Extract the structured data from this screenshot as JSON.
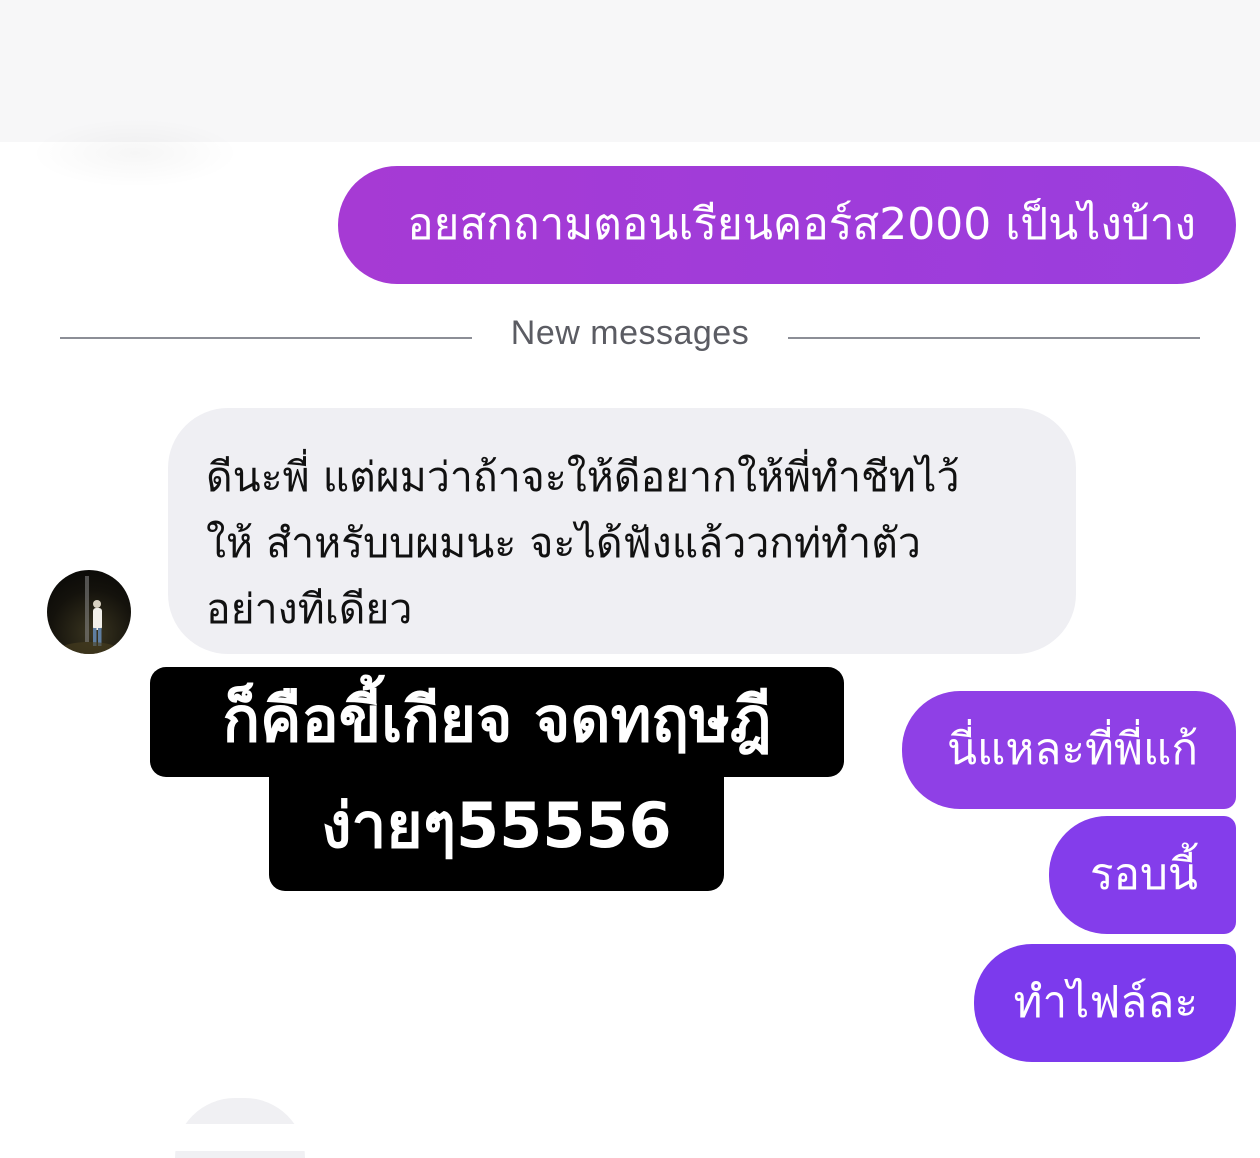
{
  "conversation": {
    "outgoing_1": "อยสกถามตอนเรียนคอร์ส2000 เป็นไงบ้าง",
    "divider_label": "New messages",
    "incoming_1": "ดีนะพี่ แต่ผมว่าถ้าจะให้ดีอยากให้พี่ทำชีทไว้\nให้ สำหรับบผมนะ จะได้ฟังแล้ววกท่ทำตัว\nอย่างทีเดียว",
    "outgoing_2": "นี่แหละที่พี่แก้",
    "outgoing_3": "รอบนี้",
    "outgoing_4": "ทำไฟล์ละ"
  },
  "overlay_caption": {
    "line_1": "ก็คือขี้เกียจ จดทฤษฎี",
    "line_2": "ง่ายๆ55556"
  },
  "colors": {
    "outgoing_bubble": "#a63ad4",
    "outgoing_bubble_late": "#7c3aed",
    "incoming_bubble": "#efeff3",
    "caption_bg": "#000000"
  }
}
